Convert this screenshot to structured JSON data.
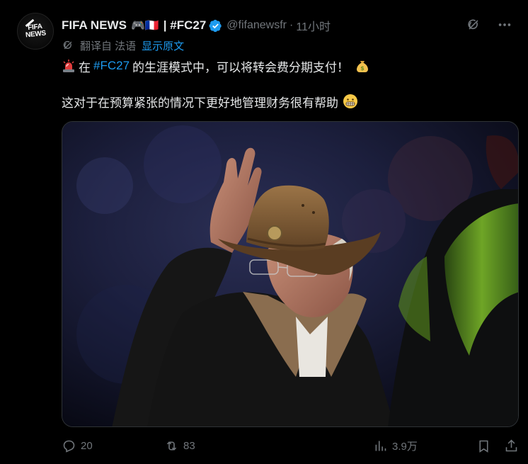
{
  "author": {
    "name": "FIFA NEWS",
    "name_emoji": "🎮🇫🇷",
    "name_tag": "| #FC27",
    "handle": "@fifanewsfr",
    "separator": "·",
    "time": "11小时",
    "avatar_text": "FIFA NEWS"
  },
  "translation": {
    "label": "翻译自 法语",
    "link": "显示原文"
  },
  "tweet": {
    "line1_prefix": "在",
    "line1_hashtag": "#FC27",
    "line1_suffix": "的生涯模式中，可以将转会费分期支付！",
    "line2": "这对于在预算紧张的情况下更好地管理财务很有帮助"
  },
  "actions": {
    "replies": "20",
    "retweets": "83",
    "views": "3.9万"
  },
  "colors": {
    "accent": "#1d9bf0",
    "muted": "#71767b",
    "text": "#e7e9ea",
    "background": "#000000"
  },
  "icons": [
    "verified-badge-icon",
    "grok-icon",
    "more-icon",
    "translate-icon",
    "reply-icon",
    "retweet-icon",
    "views-icon",
    "bookmark-icon",
    "share-icon"
  ]
}
